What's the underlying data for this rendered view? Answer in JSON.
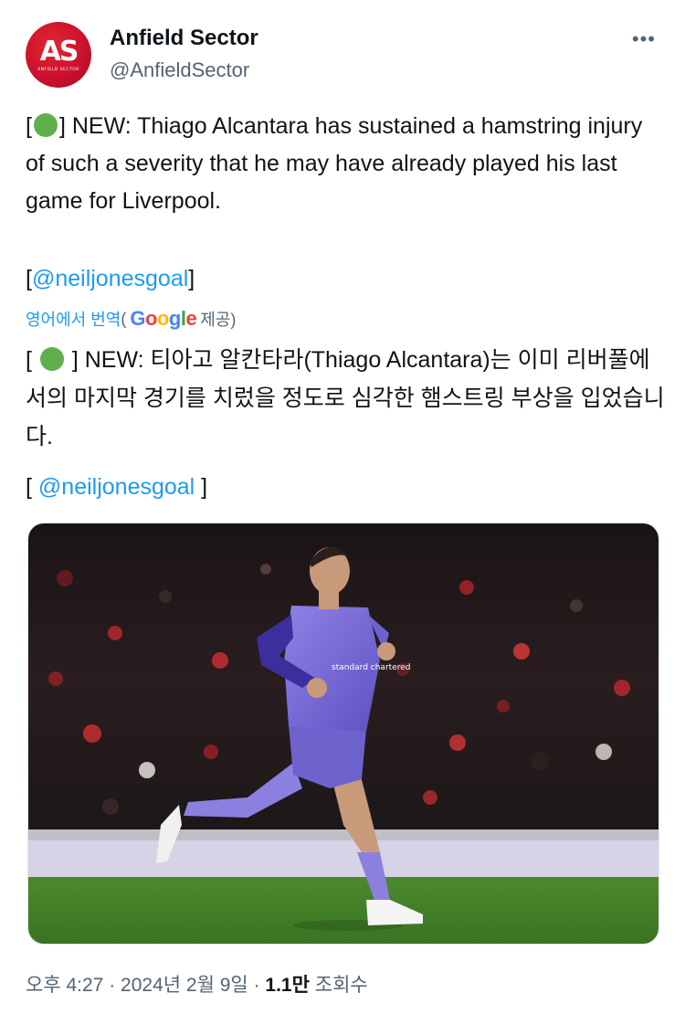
{
  "author": {
    "avatar_text": "AS",
    "avatar_subtext": "ANFIELD SECTOR",
    "display_name": "Anfield Sector",
    "handle": "@AnfieldSector"
  },
  "more_label": "•••",
  "tweet": {
    "line_prefix": "[",
    "line_after_dot": "] NEW: Thiago Alcantara has sustained a hamstring injury of such a severity that he may have already played his last game for Liverpool.",
    "mention_open": "[",
    "mention": "@neiljonesgoal",
    "mention_close": "]"
  },
  "translation": {
    "label": "영어에서 번역",
    "paren_open": "(",
    "provider_letters": [
      "G",
      "o",
      "o",
      "g",
      "l",
      "e"
    ],
    "provided_by": "제공)"
  },
  "translated_text": {
    "prefix": "[ ",
    "after_dot": " ] NEW: 티아고 알칸타라(Thiago Alcantara)는 이미 리버풀에서의 마지막 경기를 치렀을 정도로 심각한 햄스트링 부상을 입었습니다.",
    "mention_open": "[ ",
    "mention": "@neiljonesgoal",
    "mention_close": " ]"
  },
  "media": {
    "kit_text": "standard chartered"
  },
  "meta": {
    "time": "오후 4:27",
    "sep1": " · ",
    "date": "2024년 2월 9일",
    "sep2": " · ",
    "views": "1.1만",
    "views_label": " 조회수"
  },
  "colors": {
    "link": "#1d9bf0",
    "brand_red": "#c8102e",
    "status_dot": "#5fb04b",
    "kit_purple": "#7b6fd6"
  }
}
